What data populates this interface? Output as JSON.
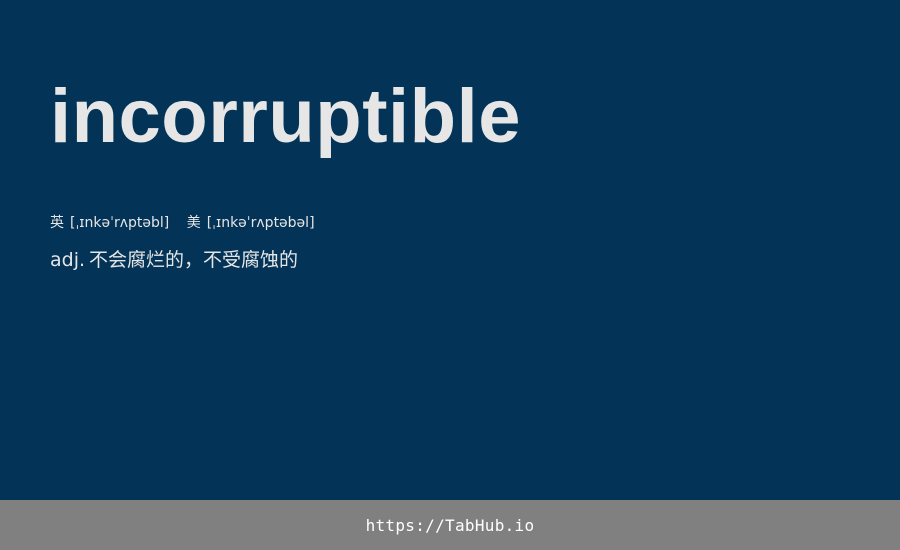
{
  "word": "incorruptible",
  "phonetics": {
    "uk_label": "英",
    "uk_ipa": "[ˌɪnkəˈrʌptəbl]",
    "us_label": "美",
    "us_ipa": "[ˌɪnkəˈrʌptəbəl]"
  },
  "definition": {
    "pos": "adj.",
    "text": "不会腐烂的，不受腐蚀的"
  },
  "footer": {
    "link": "https://TabHub.io"
  },
  "colors": {
    "background": "#033357",
    "text": "#e6e6e6",
    "footer_background": "#808080",
    "footer_text": "#ffffff"
  }
}
